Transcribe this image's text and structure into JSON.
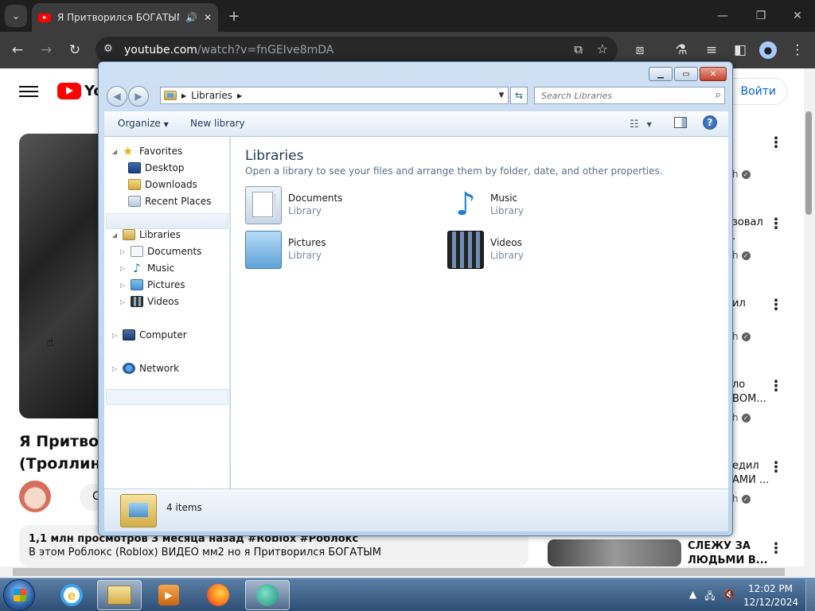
{
  "browser": {
    "tab_title": "Я Притворился БОГАТЫМ",
    "url_host": "youtube.com",
    "url_path": "/watch?v=fnGEIve8mDA",
    "tab_list_glyph": "⌄",
    "new_tab_glyph": "+",
    "icons": [
      "back-icon",
      "forward-icon",
      "reload-icon",
      "cast-icon",
      "star-icon",
      "extensions-icon",
      "labs-icon",
      "reading-list-icon",
      "side-panel-icon",
      "profile-icon",
      "menu-icon"
    ]
  },
  "youtube": {
    "logo_text": "Yo",
    "signin_label": "Войти",
    "video_title_line1": "Я Притворился",
    "video_title_line2": "(Троллинг",
    "subscribe_label": "С",
    "description": {
      "meta": "1,1 млн просмотров  3 месяца назад  #Roblox #Роблокс",
      "text": "В этом Роблокс (Roblox) ВИДЕО мм2 но я Притворился БОГАТЫМ"
    },
    "recommendations": [
      {
        "line1": "",
        "line2": "h"
      },
      {
        "line1": "зовал",
        "line1b": ".",
        "line2": "h"
      },
      {
        "line1": "ил",
        "line2": "h"
      },
      {
        "line1": "ло",
        "line1b": "ВОМ...",
        "line2": "h"
      },
      {
        "line1": "едил",
        "line1b": "АМИ ...",
        "line2": "h"
      }
    ],
    "bottom_rec": {
      "line1": "СЛЕЖУ ЗА",
      "line2": "ЛЮДЬМИ В..."
    }
  },
  "explorer": {
    "breadcrumb": "Libraries",
    "search_placeholder": "Search Libraries",
    "organize_label": "Organize",
    "new_library_label": "New library",
    "nav": {
      "favorites": "Favorites",
      "desktop": "Desktop",
      "downloads": "Downloads",
      "recent": "Recent Places",
      "libraries": "Libraries",
      "documents": "Documents",
      "music": "Music",
      "pictures": "Pictures",
      "videos": "Videos",
      "computer": "Computer",
      "network": "Network"
    },
    "content_title": "Libraries",
    "content_subtitle": "Open a library to see your files and arrange them by folder, date, and other properties.",
    "items": [
      {
        "name": "Documents",
        "type": "Library"
      },
      {
        "name": "Music",
        "type": "Library"
      },
      {
        "name": "Pictures",
        "type": "Library"
      },
      {
        "name": "Videos",
        "type": "Library"
      }
    ],
    "item_count": "4 items"
  },
  "taskbar": {
    "time": "12:02 PM",
    "date": "12/12/2024"
  },
  "colors": {
    "chrome_dark": "#1f1f1f",
    "yt_red": "#ff0000",
    "explorer_title": "#1e395b",
    "taskbar": "#2d4e75"
  }
}
